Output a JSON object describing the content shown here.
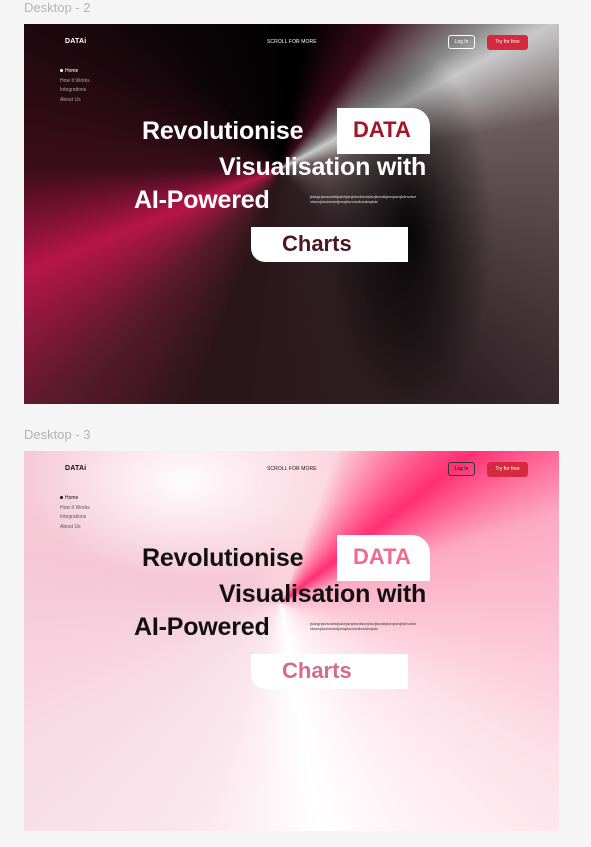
{
  "frames": [
    {
      "label": "Desktop - 2",
      "theme": "dark",
      "logo": "DATAi",
      "scroll_hint": "SCROLL FOR MORE",
      "login": "Log In",
      "try": "Try for free",
      "nav": [
        "Home",
        "How It Works",
        "Integrations",
        "About Us"
      ],
      "headline": [
        "Revolutionise",
        "Visualisation with",
        "AI-Powered"
      ],
      "data_word": "DATA",
      "charts_word": "Charts",
      "paragraph": "jskegnjsvsndnkjsdcbjsnjdnvdsnejdsvjksndkjsnvjsnvjkdnvdsnvksnvjdsdnvskdjvnsjdsnvsdkvsdvsjkdv"
    },
    {
      "label": "Desktop - 3",
      "theme": "light",
      "logo": "DATAi",
      "scroll_hint": "SCROLL FOR MORE",
      "login": "Log In",
      "try": "Try for free",
      "nav": [
        "Home",
        "How It Works",
        "Integrations",
        "About Us"
      ],
      "headline": [
        "Revolutionise",
        "Visualisation with",
        "AI-Powered"
      ],
      "data_word": "DATA",
      "charts_word": "Charts",
      "paragraph": "jskegnjsvsndnkjsdcbjsnjdnvdsnejdsvjksndkjsnvjsnvjkdnvdsnvksnvjdsdnvskdjvnsjdsnvsdkvsdvsjkdv"
    }
  ],
  "colors": {
    "accent": "#d52a3d",
    "canvas": "#f5f5f5"
  }
}
